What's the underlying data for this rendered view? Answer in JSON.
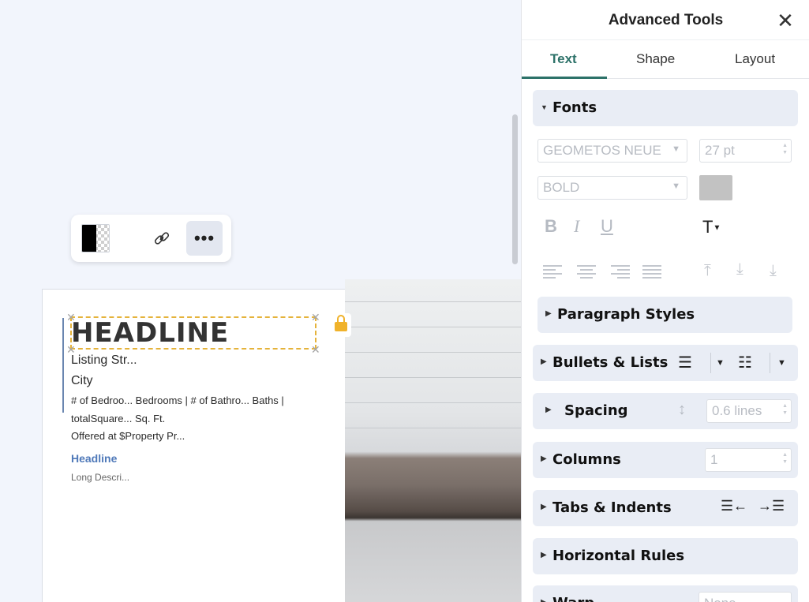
{
  "canvas": {
    "toolbar": {
      "transparency_icon": "transparency-icon",
      "link_icon": "link-icon",
      "more_label": "•••"
    },
    "text": {
      "headline": "HEADLINE",
      "street": "Listing Str...",
      "city": "City",
      "details": "# of Bedroo... Bedrooms  |  # of Bathro... Baths  |",
      "sqft": "totalSquare... Sq. Ft.",
      "offer": "Offered at $Property Pr...",
      "headline2": "Headline",
      "long_desc": "Long Descri..."
    }
  },
  "panel": {
    "title": "Advanced Tools",
    "close_label": "✕",
    "tabs": [
      {
        "label": "Text",
        "active": true
      },
      {
        "label": "Shape",
        "active": false
      },
      {
        "label": "Layout",
        "active": false
      }
    ],
    "fonts": {
      "title": "Fonts",
      "font_family": "GEOMETOS NEUE",
      "font_size": "27 pt",
      "font_weight": "BOLD",
      "color": "#c2c2c2",
      "bold": "B",
      "italic": "I",
      "underline": "U",
      "text_transform": "T"
    },
    "sections": {
      "paragraph_styles": "Paragraph Styles",
      "bullets_lists": "Bullets & Lists",
      "spacing": "Spacing",
      "spacing_value": "0.6 lines",
      "columns": "Columns",
      "columns_value": "1",
      "tabs_indents": "Tabs & Indents",
      "horizontal_rules": "Horizontal Rules",
      "warp": "Warp",
      "warp_value": "None"
    }
  },
  "colors": {
    "accent": "#2d7269",
    "selection": "#e5b33b",
    "section_bg": "#e9edf5",
    "link_blue": "#4f79b9"
  }
}
